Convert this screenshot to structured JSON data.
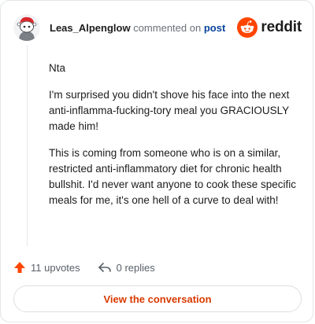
{
  "header": {
    "username": "Leas_Alpenglow",
    "action": "commented on",
    "post_link": "post",
    "brand": "reddit"
  },
  "comment": {
    "paragraphs": [
      "Nta",
      "I'm surprised you didn't shove his face into the next anti-inflamma-fucking-tory meal you GRACIOUSLY made him!",
      "This is coming from someone who is on a similar, restricted anti-inflammatory diet for chronic health bullshit. I'd never want anyone to cook these specific meals for me, it's one hell of a curve to deal with!"
    ]
  },
  "footer": {
    "upvotes": "11 upvotes",
    "replies": "0 replies"
  },
  "cta": {
    "label": "View the conversation"
  },
  "colors": {
    "brand_orange": "#ff4500",
    "link_blue": "#0a449b",
    "cta_text": "#d93a00"
  },
  "icons": {
    "avatar": "snoo-avatar",
    "brand": "reddit-logo-icon",
    "upvote": "upvote-arrow-icon",
    "reply": "reply-arrow-icon"
  }
}
